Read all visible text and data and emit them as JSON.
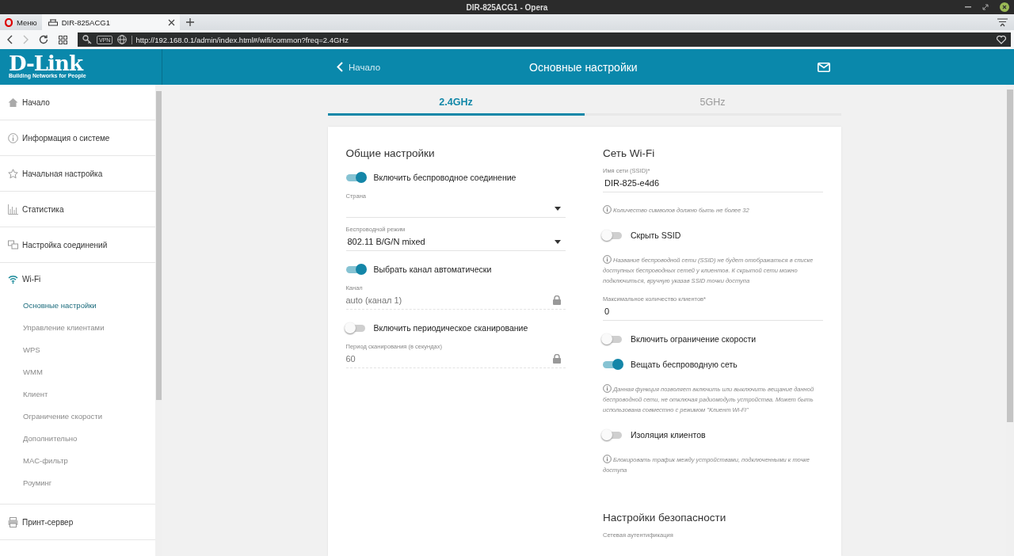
{
  "window": {
    "title": "DIR-825ACG1 - Opera"
  },
  "browser_tabs": [
    {
      "kind": "menu",
      "label": "Меню",
      "selected": false
    },
    {
      "kind": "page",
      "label": "DIR-825ACG1",
      "selected": true
    }
  ],
  "address_bar": {
    "vpn_badge": "VPN",
    "url": "http://192.168.0.1/admin/index.html#/wifi/common?freq=2.4GHz"
  },
  "header": {
    "logo": "D-Link",
    "tagline": "Building Networks for People",
    "back_link": "Начало",
    "title": "Основные настройки"
  },
  "sidebar": {
    "items": [
      {
        "label": "Начало",
        "expanded": false
      },
      {
        "label": "Информация о системе",
        "expanded": false
      },
      {
        "label": "Начальная настройка",
        "expanded": false
      },
      {
        "label": "Статистика",
        "expanded": false
      },
      {
        "label": "Настройка соединений",
        "expanded": false
      },
      {
        "label": "Wi-Fi",
        "expanded": true,
        "children": [
          {
            "label": "Основные настройки",
            "selected": true
          },
          {
            "label": "Управление клиентами",
            "selected": false
          },
          {
            "label": "WPS",
            "selected": false
          },
          {
            "label": "WMM",
            "selected": false
          },
          {
            "label": "Клиент",
            "selected": false
          },
          {
            "label": "Ограничение скорости",
            "selected": false
          },
          {
            "label": "Дополнительно",
            "selected": false
          },
          {
            "label": "MAC-фильтр",
            "selected": false
          },
          {
            "label": "Роуминг",
            "selected": false
          }
        ]
      },
      {
        "label": "Принт-сервер",
        "expanded": false
      }
    ]
  },
  "band_tabs": [
    {
      "label": "2.4GHz",
      "selected": true
    },
    {
      "label": "5GHz",
      "selected": false
    }
  ],
  "general": {
    "title": "Общие настройки",
    "rows": [
      {
        "kind": "toggle",
        "label": "Включить беспроводное соединение",
        "on": true
      },
      {
        "kind": "select",
        "label": "Страна",
        "value": ""
      },
      {
        "kind": "select",
        "label": "Беспроводной режим",
        "value": "802.11 B/G/N mixed"
      },
      {
        "kind": "toggle",
        "label": "Выбрать канал автоматически",
        "on": true
      },
      {
        "kind": "locked",
        "label": "Канал",
        "value": "auto (канал 1)"
      },
      {
        "kind": "toggle",
        "label": "Включить периодическое сканирование",
        "on": false
      },
      {
        "kind": "locked",
        "label": "Период сканирования (в секундах)",
        "value": "60"
      }
    ]
  },
  "wifi_network": {
    "title": "Сеть Wi-Fi",
    "rows": [
      {
        "kind": "input",
        "label": "Имя сети (SSID)*",
        "value": "DIR-825-e4d6"
      },
      {
        "kind": "hint",
        "text": "Количество символов должно быть не более 32"
      },
      {
        "kind": "toggle",
        "label": "Скрыть SSID",
        "on": false
      },
      {
        "kind": "hint",
        "text": "Название беспроводной сети (SSID) не будет отображаться в списке доступных беспроводных сетей у клиентов. К скрытой сети можно подключиться, вручную указав SSID точки доступа"
      },
      {
        "kind": "input",
        "label": "Максимальное количество клиентов*",
        "value": "0"
      },
      {
        "kind": "toggle",
        "label": "Включить ограничение скорости",
        "on": false
      },
      {
        "kind": "toggle",
        "label": "Вещать беспроводную сеть",
        "on": true
      },
      {
        "kind": "hint",
        "text": "Данная функция позволяет включить или выключить вещание данной беспроводной сети, не отключая радиомодуль устройства. Может быть использована совместно с режимом \"Клиент Wi-Fi\""
      },
      {
        "kind": "toggle",
        "label": "Изоляция клиентов",
        "on": false
      },
      {
        "kind": "hint",
        "text": "Блокировать трафик между устройствами, подключенными к точке доступа"
      },
      {
        "kind": "heading",
        "text": "Настройки безопасности"
      },
      {
        "kind": "caption",
        "text": "Сетевая аутентификация"
      }
    ]
  }
}
